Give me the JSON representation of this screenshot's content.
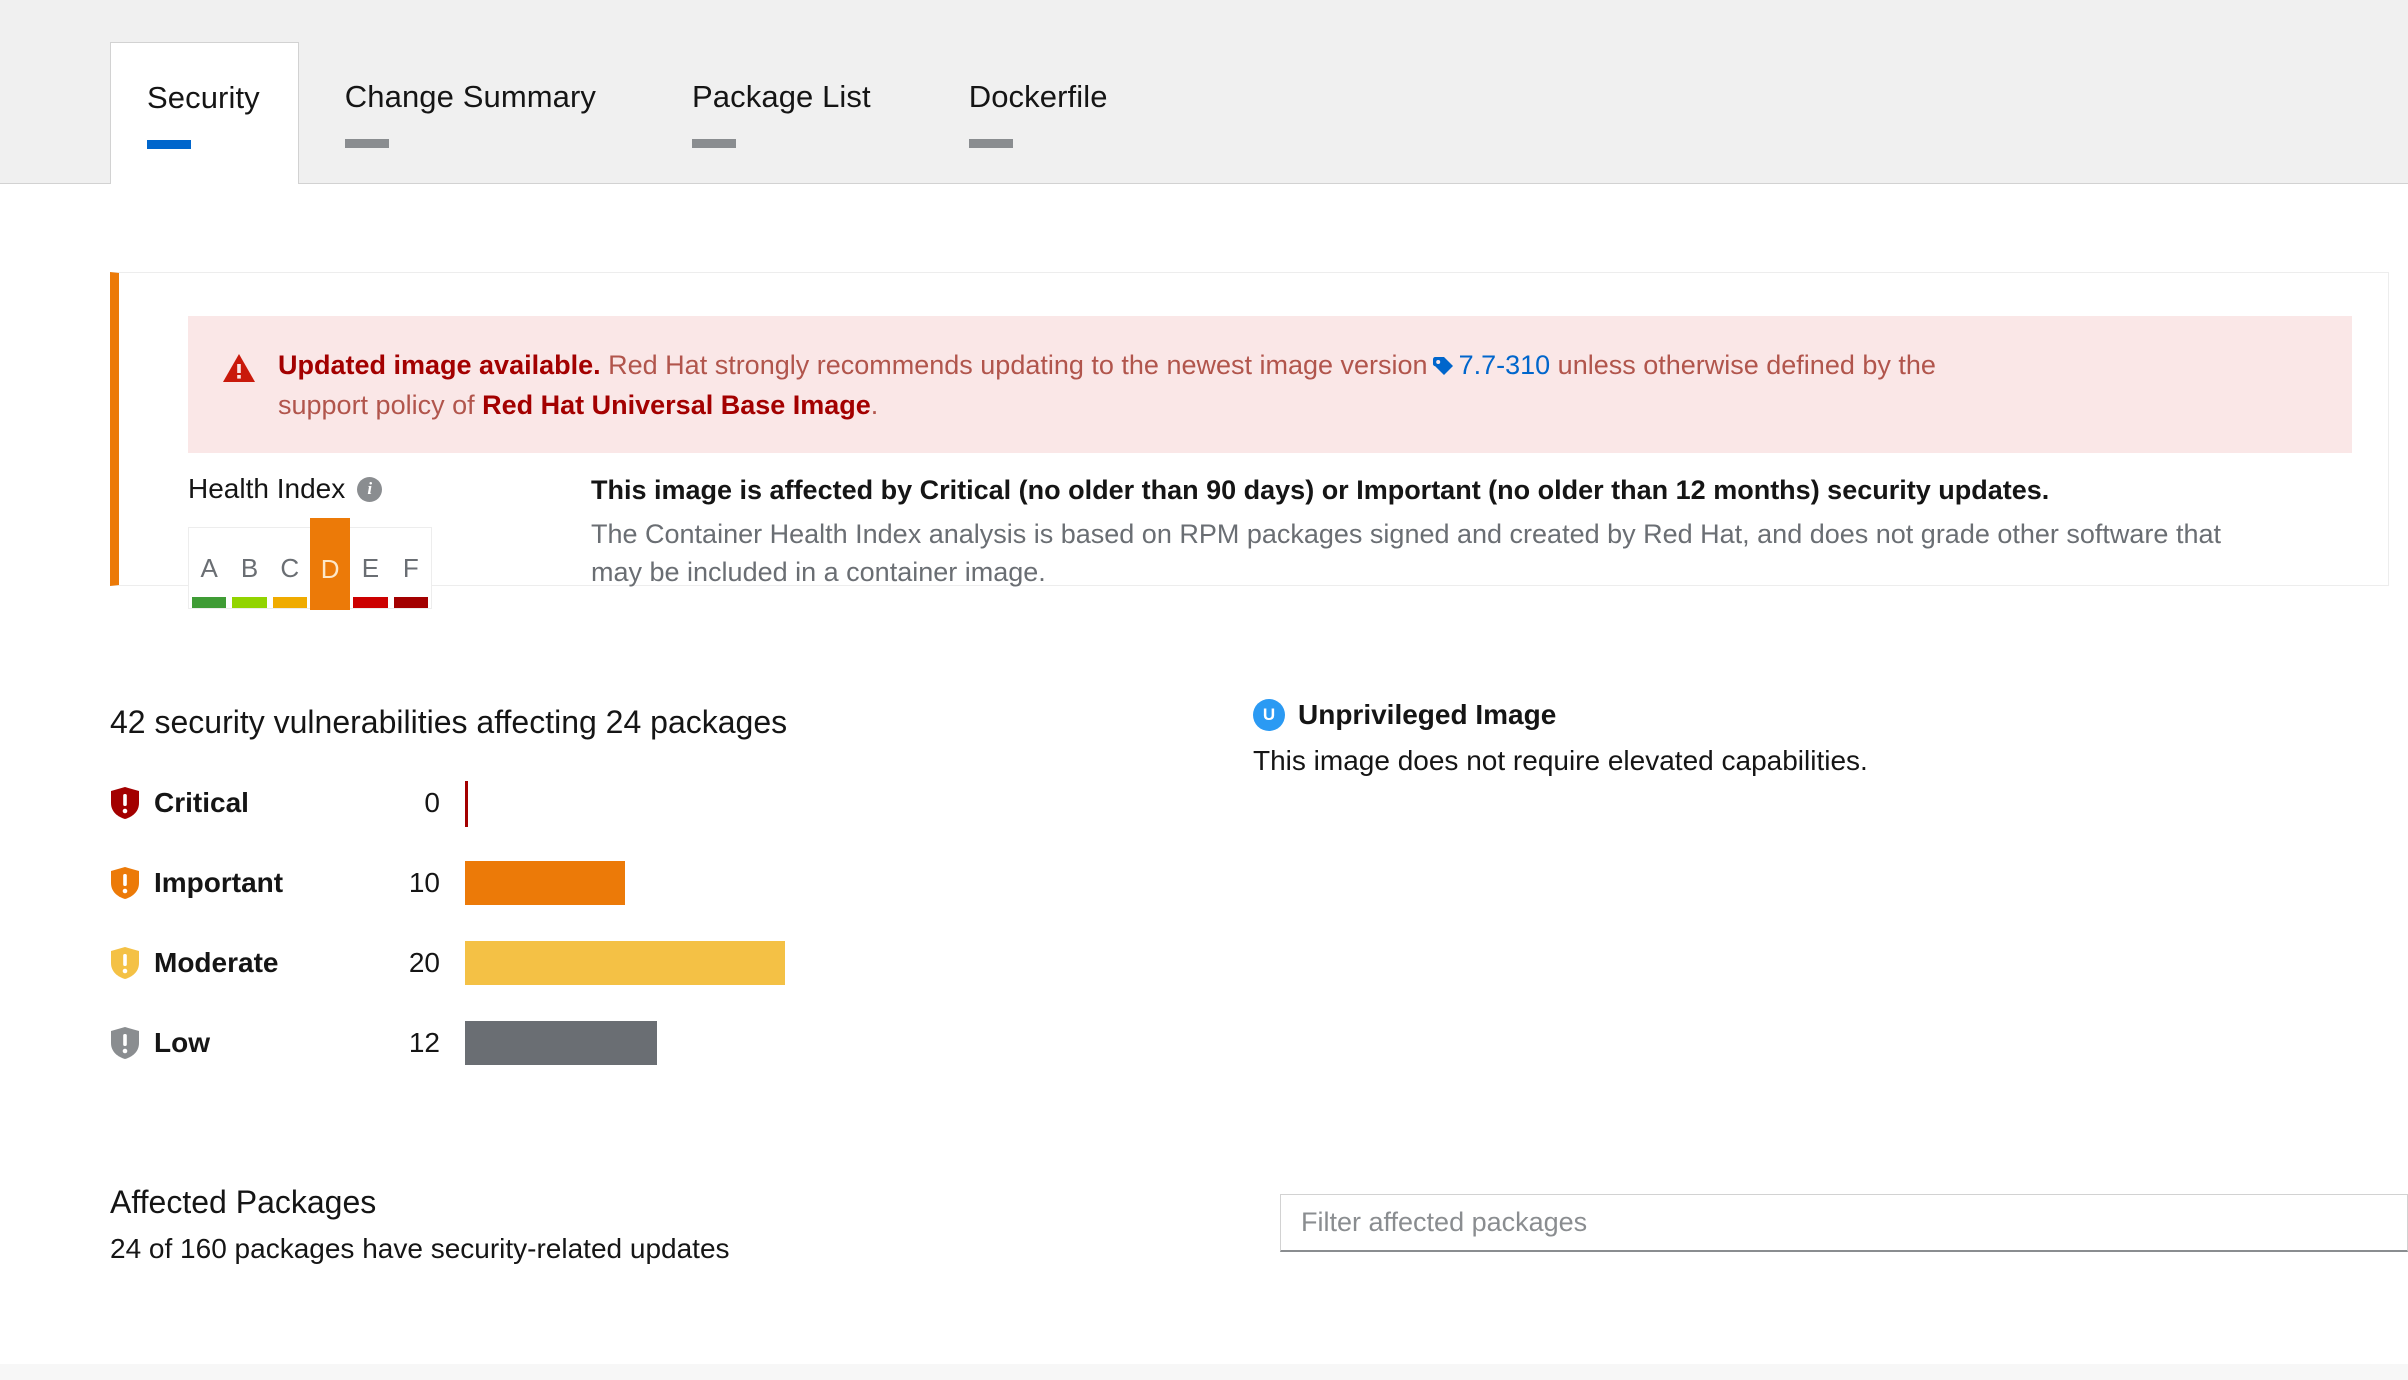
{
  "tabs": [
    {
      "label": "Security",
      "active": true
    },
    {
      "label": "Change Summary",
      "active": false
    },
    {
      "label": "Package List",
      "active": false
    },
    {
      "label": "Dockerfile",
      "active": false
    }
  ],
  "alert": {
    "icon": "warning-triangle-icon",
    "strong_text": "Updated image available.",
    "body_before": "Red Hat strongly recommends updating to the newest image version",
    "version_link": "7.7-310",
    "tag_icon": "tag-icon",
    "body_after": "unless otherwise defined by the",
    "line2_before": "support policy of",
    "line2_strong": "Red Hat Universal Base Image",
    "line2_after": ".",
    "background": "#fae7e7",
    "text_color": "#c9190b",
    "link_color": "#0066cc",
    "accent_color": "#ec7a08"
  },
  "health_index": {
    "title": "Health Index",
    "info_icon": "info-circle-icon",
    "grades": [
      {
        "letter": "A",
        "color": "#3f9c35",
        "active": false
      },
      {
        "letter": "B",
        "color": "#92d400",
        "active": false
      },
      {
        "letter": "C",
        "color": "#f0ab00",
        "active": false
      },
      {
        "letter": "D",
        "color": "#ec7a08",
        "active": true
      },
      {
        "letter": "E",
        "color": "#cc0000",
        "active": false
      },
      {
        "letter": "F",
        "color": "#a30000",
        "active": false
      }
    ],
    "headline": "This image is affected by Critical (no older than 90 days) or Important (no older than 12 months) security updates.",
    "description": "The Container Health Index analysis is based on RPM packages signed and created by Red Hat, and does not grade other software that may be included in a container image."
  },
  "vulnerabilities": {
    "title": "42 security vulnerabilities affecting 24 packages",
    "rows": [
      {
        "label": "Critical",
        "count": "0",
        "value": 0,
        "color": "#a30000",
        "icon": "shield-exclamation-icon"
      },
      {
        "label": "Important",
        "count": "10",
        "value": 10,
        "color": "#ec7a08",
        "icon": "shield-exclamation-icon"
      },
      {
        "label": "Moderate",
        "count": "20",
        "value": 20,
        "color": "#f4c145",
        "icon": "shield-exclamation-icon"
      },
      {
        "label": "Low",
        "count": "12",
        "value": 12,
        "color": "#6a6e73",
        "icon": "shield-exclamation-icon"
      }
    ]
  },
  "chart_data": {
    "type": "bar",
    "title": "42 security vulnerabilities affecting 24 packages",
    "orientation": "horizontal",
    "categories": [
      "Critical",
      "Important",
      "Moderate",
      "Low"
    ],
    "values": [
      0,
      10,
      20,
      12
    ],
    "colors": [
      "#a30000",
      "#ec7a08",
      "#f4c145",
      "#6a6e73"
    ],
    "xlabel": "",
    "ylabel": "",
    "xlim": [
      0,
      20
    ],
    "grid": false,
    "legend": false,
    "data_labels": [
      "0",
      "10",
      "20",
      "12"
    ]
  },
  "unprivileged": {
    "badge_letter": "U",
    "badge_icon": "unprivileged-badge-icon",
    "title": "Unprivileged Image",
    "description": "This image does not require elevated capabilities.",
    "badge_color": "#2b9af3"
  },
  "affected_packages": {
    "title": "Affected Packages",
    "subtitle": "24 of 160 packages have security-related updates",
    "filter_placeholder": "Filter affected packages",
    "filter_value": ""
  }
}
